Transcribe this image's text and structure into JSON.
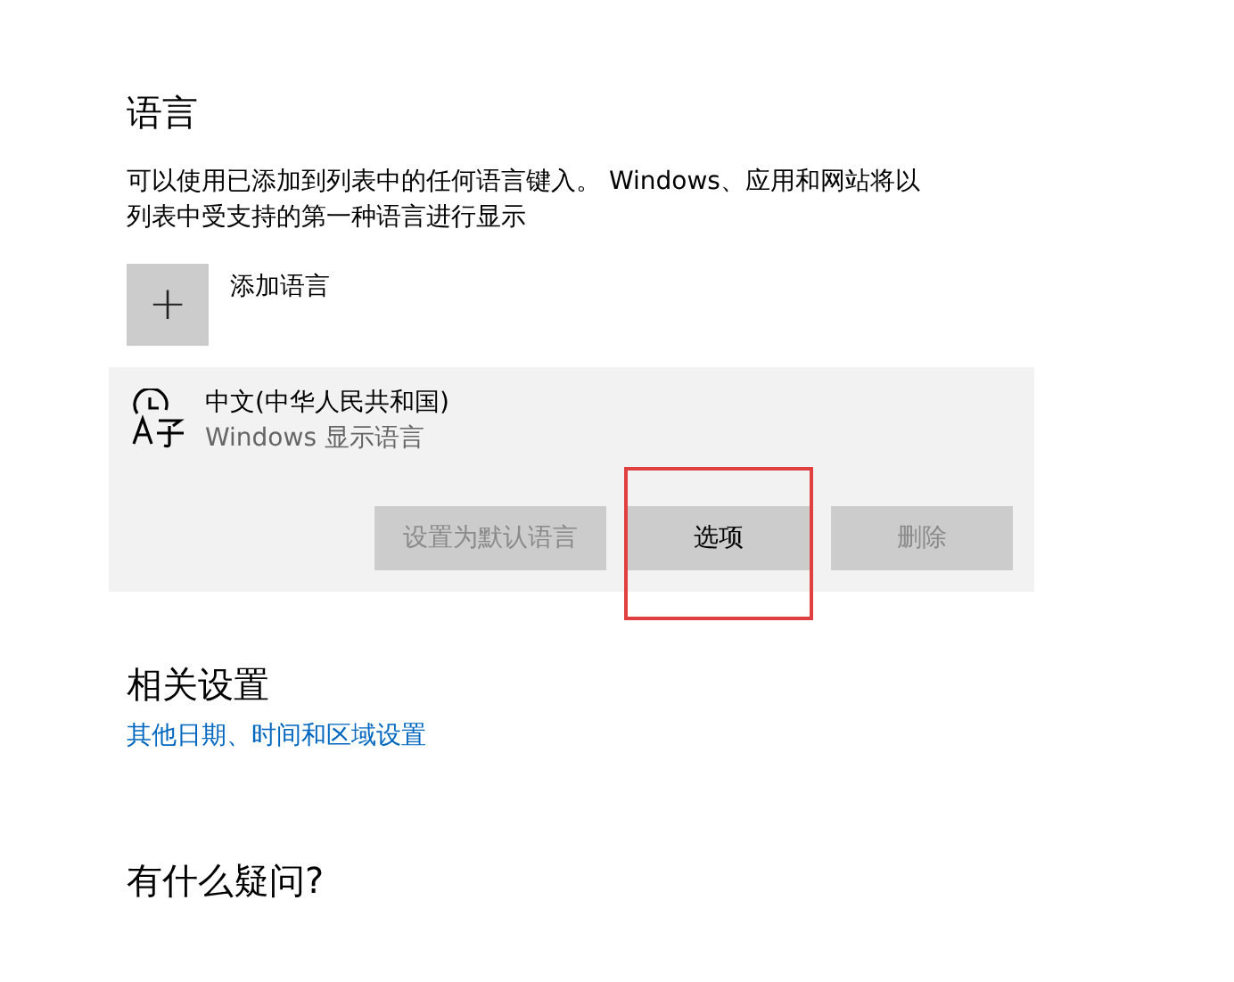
{
  "language_section": {
    "title": "语言",
    "description": "可以使用已添加到列表中的任何语言键入。 Windows、应用和网站将以列表中受支持的第一种语言进行显示",
    "add_button": {
      "icon": "+",
      "label": "添加语言"
    },
    "languages": [
      {
        "name": "中文(中华人民共和国)",
        "subtitle": "Windows 显示语言",
        "selected": true,
        "actions": [
          {
            "label": "设置为默认语言",
            "disabled": true,
            "highlighted": false
          },
          {
            "label": "选项",
            "disabled": false,
            "highlighted": true
          },
          {
            "label": "删除",
            "disabled": true,
            "highlighted": false
          }
        ]
      }
    ]
  },
  "related_settings": {
    "title": "相关设置",
    "link": "其他日期、时间和区域设置"
  },
  "help": {
    "title": "有什么疑问?"
  }
}
